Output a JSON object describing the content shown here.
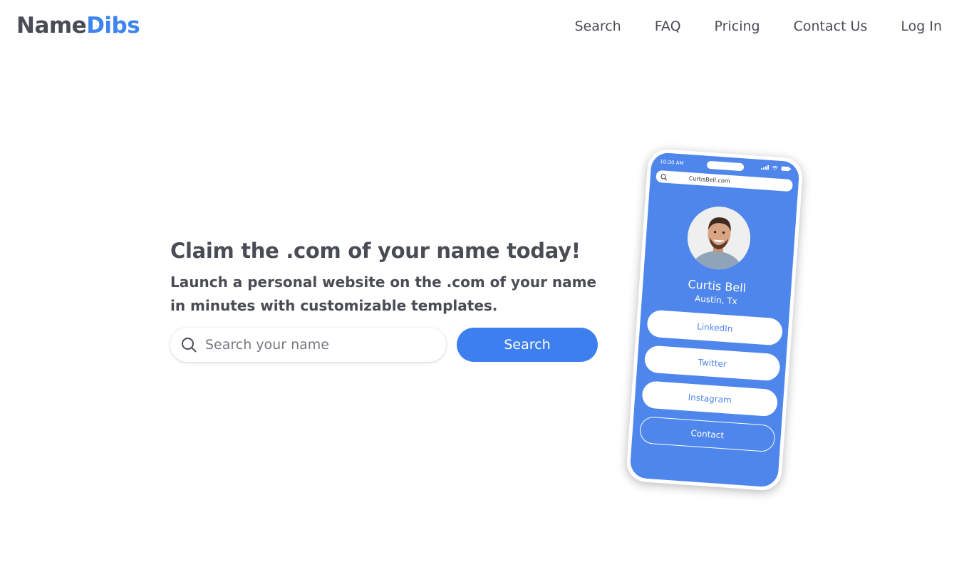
{
  "logo": {
    "part1": "Name",
    "part2": "Dibs"
  },
  "nav": {
    "items": [
      "Search",
      "FAQ",
      "Pricing",
      "Contact Us",
      "Log In"
    ]
  },
  "hero": {
    "title": "Claim the .com of your name today!",
    "subtitle": "Launch a personal website on the .com of your name in minutes with customizable templates."
  },
  "search": {
    "placeholder": "Search your name",
    "value": "",
    "button_label": "Search"
  },
  "phone": {
    "time": "10:30 AM",
    "url": "CurtisBell.com",
    "name": "Curtis Bell",
    "location": "Austin, Tx",
    "links": [
      "LinkedIn",
      "Twitter",
      "Instagram",
      "Contact"
    ]
  },
  "colors": {
    "brand_blue": "#3d84ee",
    "text": "#4a4c55",
    "phone_blue": "#4f86ec"
  },
  "icons": {
    "search": "search-icon"
  }
}
